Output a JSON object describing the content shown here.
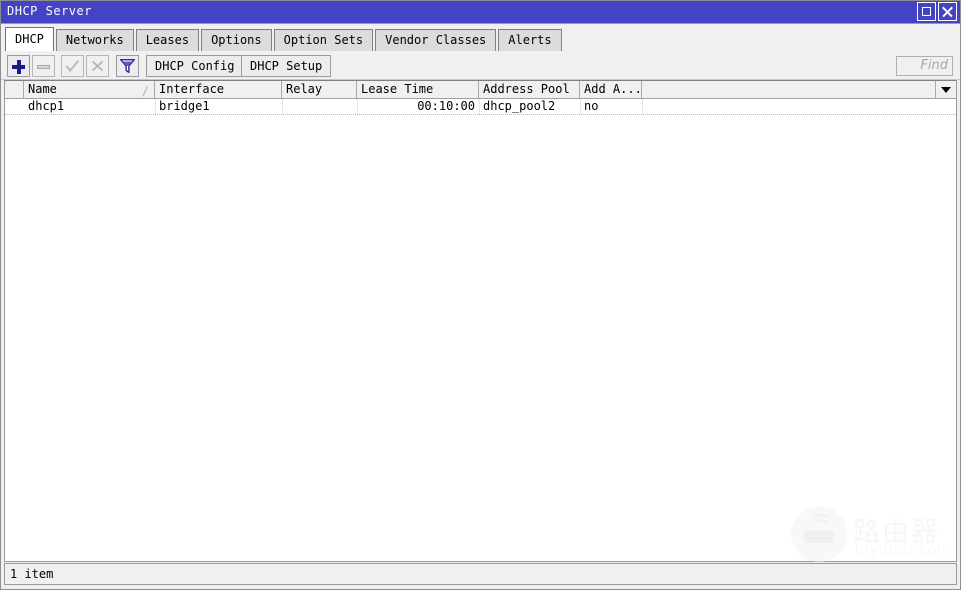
{
  "window": {
    "title": "DHCP Server",
    "maximize_label": "Maximize",
    "close_label": "Close"
  },
  "tabs": [
    {
      "label": "DHCP",
      "active": true
    },
    {
      "label": "Networks",
      "active": false
    },
    {
      "label": "Leases",
      "active": false
    },
    {
      "label": "Options",
      "active": false
    },
    {
      "label": "Option Sets",
      "active": false
    },
    {
      "label": "Vendor Classes",
      "active": false
    },
    {
      "label": "Alerts",
      "active": false
    }
  ],
  "toolbar": {
    "add_icon": "plus-icon",
    "remove_icon": "minus-icon",
    "enable_icon": "check-icon",
    "disable_icon": "cross-icon",
    "filter_icon": "funnel-icon",
    "config_button": "DHCP Config",
    "setup_button": "DHCP Setup"
  },
  "search": {
    "placeholder": "Find",
    "value": ""
  },
  "table": {
    "columns": [
      {
        "label": "Name",
        "sort_indicator": "/"
      },
      {
        "label": "Interface",
        "sort_indicator": ""
      },
      {
        "label": "Relay",
        "sort_indicator": ""
      },
      {
        "label": "Lease Time",
        "sort_indicator": ""
      },
      {
        "label": "Address Pool",
        "sort_indicator": ""
      },
      {
        "label": "Add A...",
        "sort_indicator": ""
      }
    ],
    "rows": [
      {
        "name": "dhcp1",
        "interface": "bridge1",
        "relay": "",
        "lease_time": "00:10:00",
        "address_pool": "dhcp_pool2",
        "add_arp": "no"
      }
    ],
    "column_menu_icon": "chevron-down-icon"
  },
  "status": {
    "text": "1 item"
  },
  "watermark": {
    "cn_text": "路由器",
    "url_text": "luyouqi.com",
    "icon": "router-icon"
  },
  "colors": {
    "titlebar": "#4343c4",
    "accent": "#1a1a8c",
    "chrome": "#f0f0f0",
    "content": "#ffffff"
  }
}
